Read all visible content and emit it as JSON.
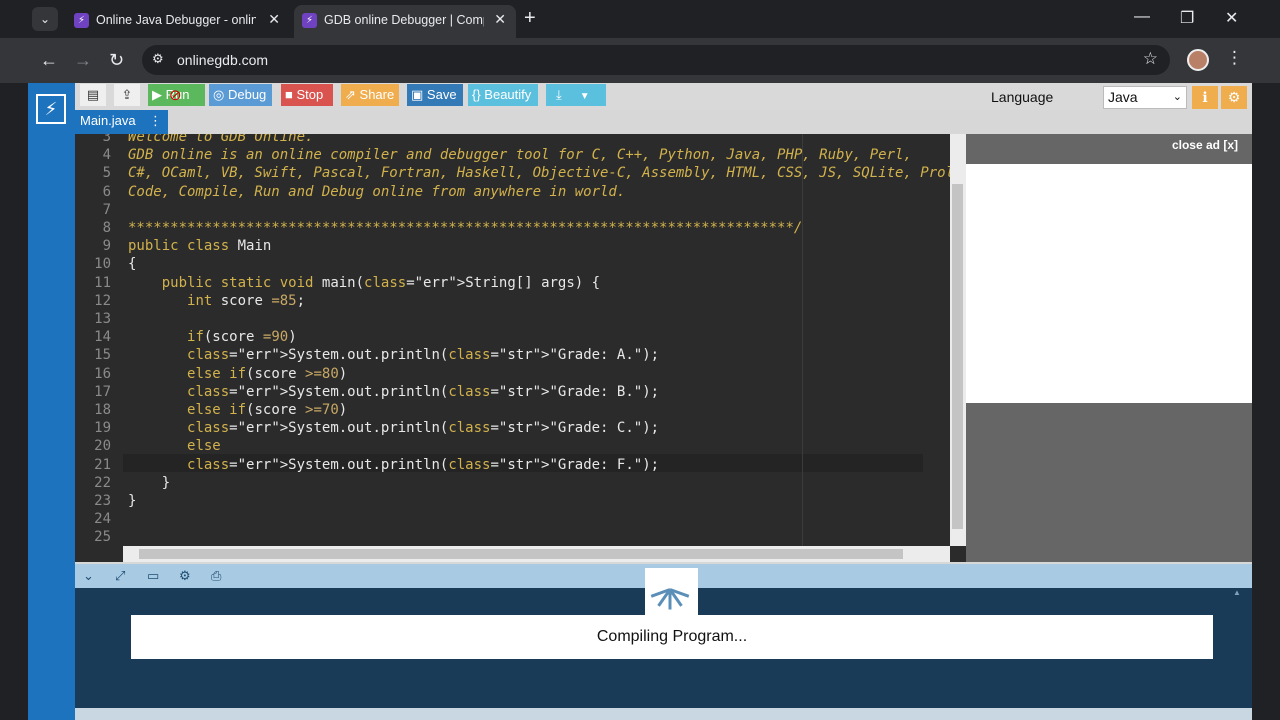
{
  "browser": {
    "tabs": [
      {
        "title": "Online Java Debugger - online c",
        "active": false
      },
      {
        "title": "GDB online Debugger | Compile",
        "active": true
      }
    ],
    "url": "onlinegdb.com",
    "newtab_glyph": "+",
    "minimize_glyph": "—",
    "restore_glyph": "❐",
    "close_glyph": "✕"
  },
  "toolbar": {
    "run_label": "Run",
    "debug_label": "Debug",
    "stop_label": "Stop",
    "share_label": "Share",
    "save_label": "Save",
    "beautify_label": "{} Beautify",
    "language_label": "Language",
    "language_value": "Java",
    "colors": {
      "run": "#5cb85c",
      "debug": "#5b9bd5",
      "stop": "#d9534f",
      "share": "#f0ad4e",
      "save": "#337ab7",
      "beautify": "#5bc0de",
      "download": "#5bc0de"
    }
  },
  "file_tab": {
    "name": "Main.java"
  },
  "editor": {
    "lines": [
      {
        "n": "3",
        "code": "Welcome to GDB Online."
      },
      {
        "n": "4",
        "code": "GDB online is an online compiler and debugger tool for C, C++, Python, Java, PHP, Ruby, Perl,"
      },
      {
        "n": "5",
        "code": "C#, OCaml, VB, Swift, Pascal, Fortran, Haskell, Objective-C, Assembly, HTML, CSS, JS, SQLite, Prol"
      },
      {
        "n": "6",
        "code": "Code, Compile, Run and Debug online from anywhere in world."
      },
      {
        "n": "7",
        "code": ""
      },
      {
        "n": "8",
        "code": "*******************************************************************************/"
      },
      {
        "n": "9",
        "code": "public class Main"
      },
      {
        "n": "10",
        "code": "{"
      },
      {
        "n": "11",
        "code": "    public static void main(String[] args) {"
      },
      {
        "n": "12",
        "code": "       int score =85;"
      },
      {
        "n": "13",
        "code": ""
      },
      {
        "n": "14",
        "code": "       if(score =90)"
      },
      {
        "n": "15",
        "code": "       System.out.println(\"Grade: A.\");"
      },
      {
        "n": "16",
        "code": "       else if(score >=80)"
      },
      {
        "n": "17",
        "code": "       System.out.println(\"Grade: B.\");"
      },
      {
        "n": "18",
        "code": "       else if(score >=70)"
      },
      {
        "n": "19",
        "code": "       System.out.println(\"Grade: C.\");"
      },
      {
        "n": "20",
        "code": "       else"
      },
      {
        "n": "21",
        "code": "       System.out.println(\"Grade: F.\");"
      },
      {
        "n": "22",
        "code": "    }"
      },
      {
        "n": "23",
        "code": "}"
      },
      {
        "n": "24",
        "code": ""
      },
      {
        "n": "25",
        "code": ""
      }
    ]
  },
  "ad": {
    "close_label": "close ad [x]"
  },
  "console": {
    "status": "Compiling Program..."
  }
}
